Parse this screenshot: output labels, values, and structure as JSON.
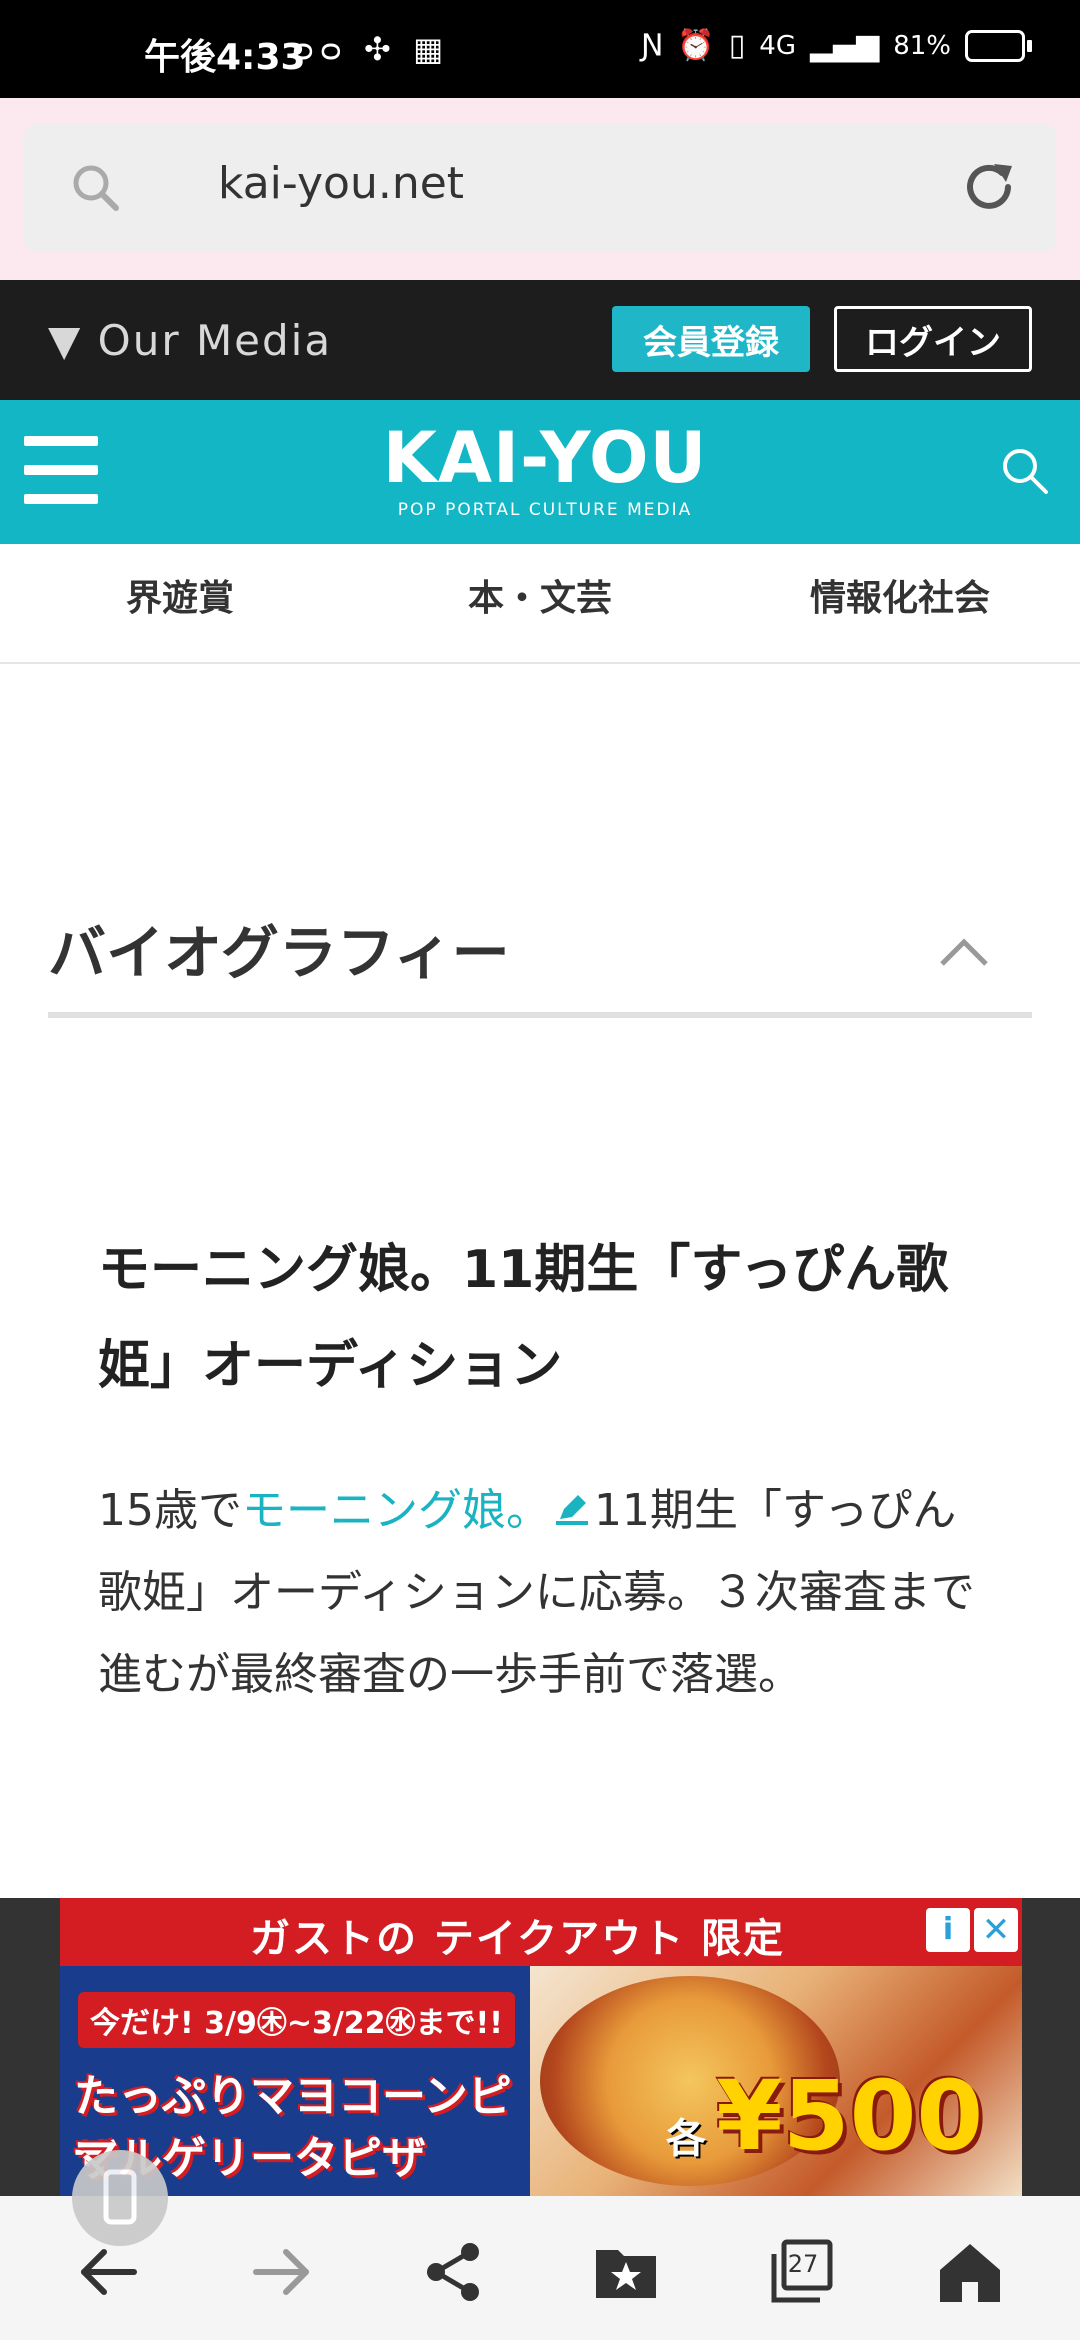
{
  "status_bar": {
    "time": "午後4:33",
    "left_icons": "ᴑᴑ ✣ ▦",
    "network": "4G",
    "battery": "81%",
    "battery_level": 0.81
  },
  "address_bar": {
    "url": "kai-you.net"
  },
  "media_bar": {
    "label": "▼ Our Media",
    "register_label": "会員登録",
    "login_label": "ログイン"
  },
  "site_header": {
    "logo": "KAI-YOU",
    "tagline": "POP PORTAL CULTURE MEDIA"
  },
  "categories": [
    "界遊賞",
    "本・文芸",
    "情報化社会"
  ],
  "biography": {
    "heading": "バイオグラフィー",
    "entry_title": "モーニング娘。11期生「すっぴん歌姫」オーディション",
    "body_before": "15歳で",
    "body_link": "モーニング娘。",
    "body_after": "11期生「すっぴん歌姫」オーディションに応募。３次審査まで進むが最終審査の一歩手前で落選。"
  },
  "ad": {
    "headline": "ガストの テイクアウト 限定",
    "info_label": "i",
    "close_label": "✕",
    "promo": "今だけ! 3/9㊍~3/22㊌まで!!",
    "line1": "たっぷりマヨコーンピザ",
    "line2": "マルゲリータピザ",
    "each": "各",
    "price": "¥500"
  },
  "toolbar": {
    "tab_count": "27"
  },
  "colors": {
    "accent": "#13b6c4",
    "link": "#19b3c1",
    "dark_bar": "#1d1d1d"
  }
}
